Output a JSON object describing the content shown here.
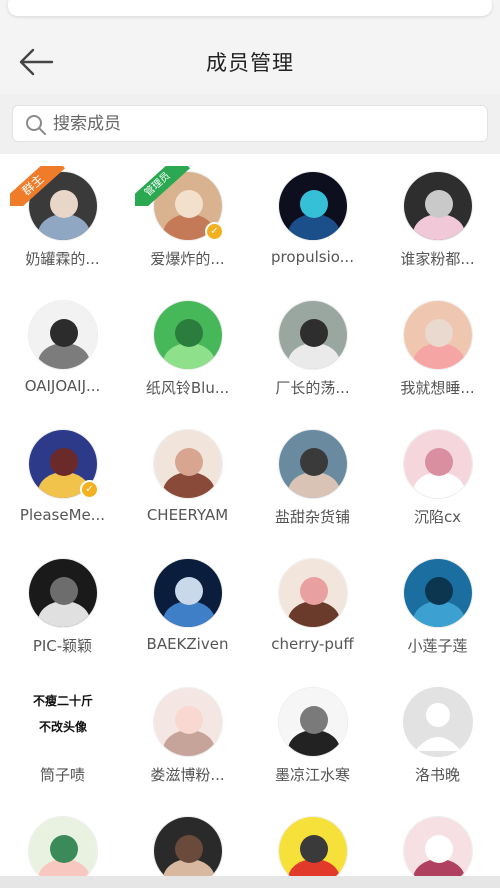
{
  "header": {
    "title": "成员管理",
    "back_icon": "arrow-left-icon"
  },
  "search": {
    "placeholder": "搜索成员",
    "icon": "search-icon"
  },
  "colors": {
    "owner_badge": "#f07c2a",
    "admin_badge": "#2aa852",
    "verified": "#f3b01f",
    "header_bg": "#f4f4f4"
  },
  "members": [
    {
      "name": "奶罐霖的...",
      "badge": "群主",
      "role": "owner"
    },
    {
      "name": "爱爆炸的...",
      "badge": "管理员",
      "role": "admin",
      "verified": true
    },
    {
      "name": "propulsio..."
    },
    {
      "name": "谁家粉都..."
    },
    {
      "name": "OAIJOAIJ..."
    },
    {
      "name": "纸风铃Blu..."
    },
    {
      "name": "厂长的荡..."
    },
    {
      "name": "我就想睡..."
    },
    {
      "name": "PleaseMe...",
      "verified": true
    },
    {
      "name": "CHEERYAM"
    },
    {
      "name": "盐甜杂货铺"
    },
    {
      "name": "沉陷cx"
    },
    {
      "name": "PIC-颖颖"
    },
    {
      "name": "BAEKZiven"
    },
    {
      "name": "cherry-puff"
    },
    {
      "name": "小莲子莲"
    },
    {
      "name": "筒子啧",
      "text_avatar": [
        "不瘦二十斤",
        "不改头像"
      ]
    },
    {
      "name": "娄滋博粉..."
    },
    {
      "name": "墨凉江水寒"
    },
    {
      "name": "洛书晚"
    },
    {
      "name": ""
    },
    {
      "name": ""
    },
    {
      "name": ""
    },
    {
      "name": ""
    }
  ]
}
